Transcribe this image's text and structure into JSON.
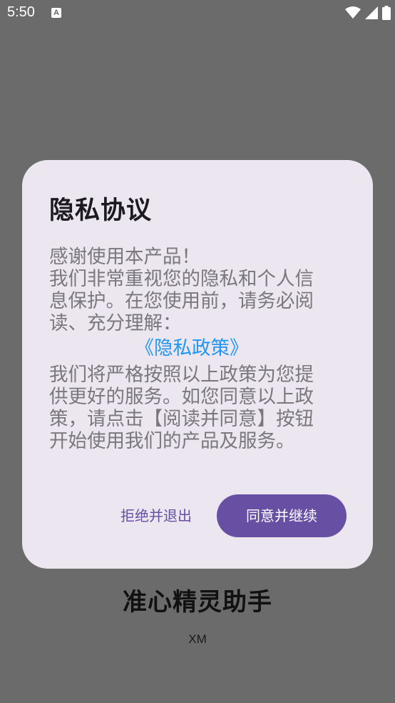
{
  "status_bar": {
    "time": "5:50",
    "notification_icon_letter": "A",
    "icons": [
      "wifi-icon",
      "signal-icon",
      "battery-icon"
    ]
  },
  "background": {
    "app_name": "准心精灵助手",
    "subtitle": "XM"
  },
  "dialog": {
    "title": "隐私协议",
    "body_lines_top": [
      "感谢使用本产品！",
      "我们非常重视您的隐私和个人信",
      "息保护。在您使用前，请务必阅",
      "读、充分理解："
    ],
    "policy_link": "《隐私政策》",
    "body_lines_bottom": [
      "我们将严格按照以上政策为您提",
      "供更好的服务。如您同意以上政",
      "策，请点击【阅读并同意】按钮",
      "开始使用我们的产品及服务。"
    ],
    "decline_label": "拒绝并退出",
    "accept_label": "同意并继续"
  },
  "colors": {
    "scrim": "#6b6b6b",
    "dialog_bg": "#ebe6ef",
    "primary": "#6750a4",
    "link": "#2196f3",
    "body_text": "#7a787c"
  }
}
